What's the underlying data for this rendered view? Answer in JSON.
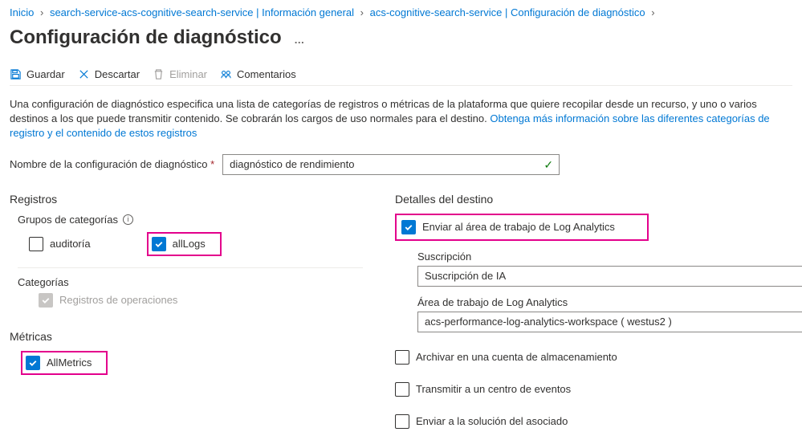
{
  "breadcrumb": {
    "home": "Inicio",
    "item1": "search-service-acs-cognitive-search-service | Información general",
    "item2": "acs-cognitive-search-service | Configuración de diagnóstico"
  },
  "page_title": "Configuración de diagnóstico",
  "title_dots": "…",
  "toolbar": {
    "save": "Guardar",
    "discard": "Descartar",
    "delete": "Eliminar",
    "feedback": "Comentarios"
  },
  "description": {
    "line1": "Una configuración de diagnóstico especifica una lista de categorías de registros o métricas de la plataforma que quiere recopilar desde un recurso, y uno o varios destinos a los que puede transmitir contenido. Se cobrarán los cargos de uso normales para el destino. ",
    "link": "Obtenga más información sobre las diferentes categorías de registro y el contenido de estos registros"
  },
  "name_field": {
    "label": "Nombre de la configuración de diagnóstico",
    "value": "diagnóstico de rendimiento"
  },
  "logs": {
    "heading": "Registros",
    "groups_heading": "Grupos de categorías",
    "audit": "auditoría",
    "alllogs": "allLogs",
    "categories_heading": "Categorías",
    "operations": "Registros de operaciones"
  },
  "metrics": {
    "heading": "Métricas",
    "allmetrics": "AllMetrics"
  },
  "destination": {
    "heading": "Detalles del destino",
    "log_analytics": "Enviar al área de trabajo de Log Analytics",
    "subscription_label": "Suscripción",
    "subscription_value": "Suscripción de IA",
    "workspace_label": "Área de trabajo de Log Analytics",
    "workspace_value": "acs-performance-log-analytics-workspace ( westus2 )",
    "storage": "Archivar en una cuenta de almacenamiento",
    "eventhub": "Transmitir a un centro de eventos",
    "partner": "Enviar a la solución del asociado"
  }
}
